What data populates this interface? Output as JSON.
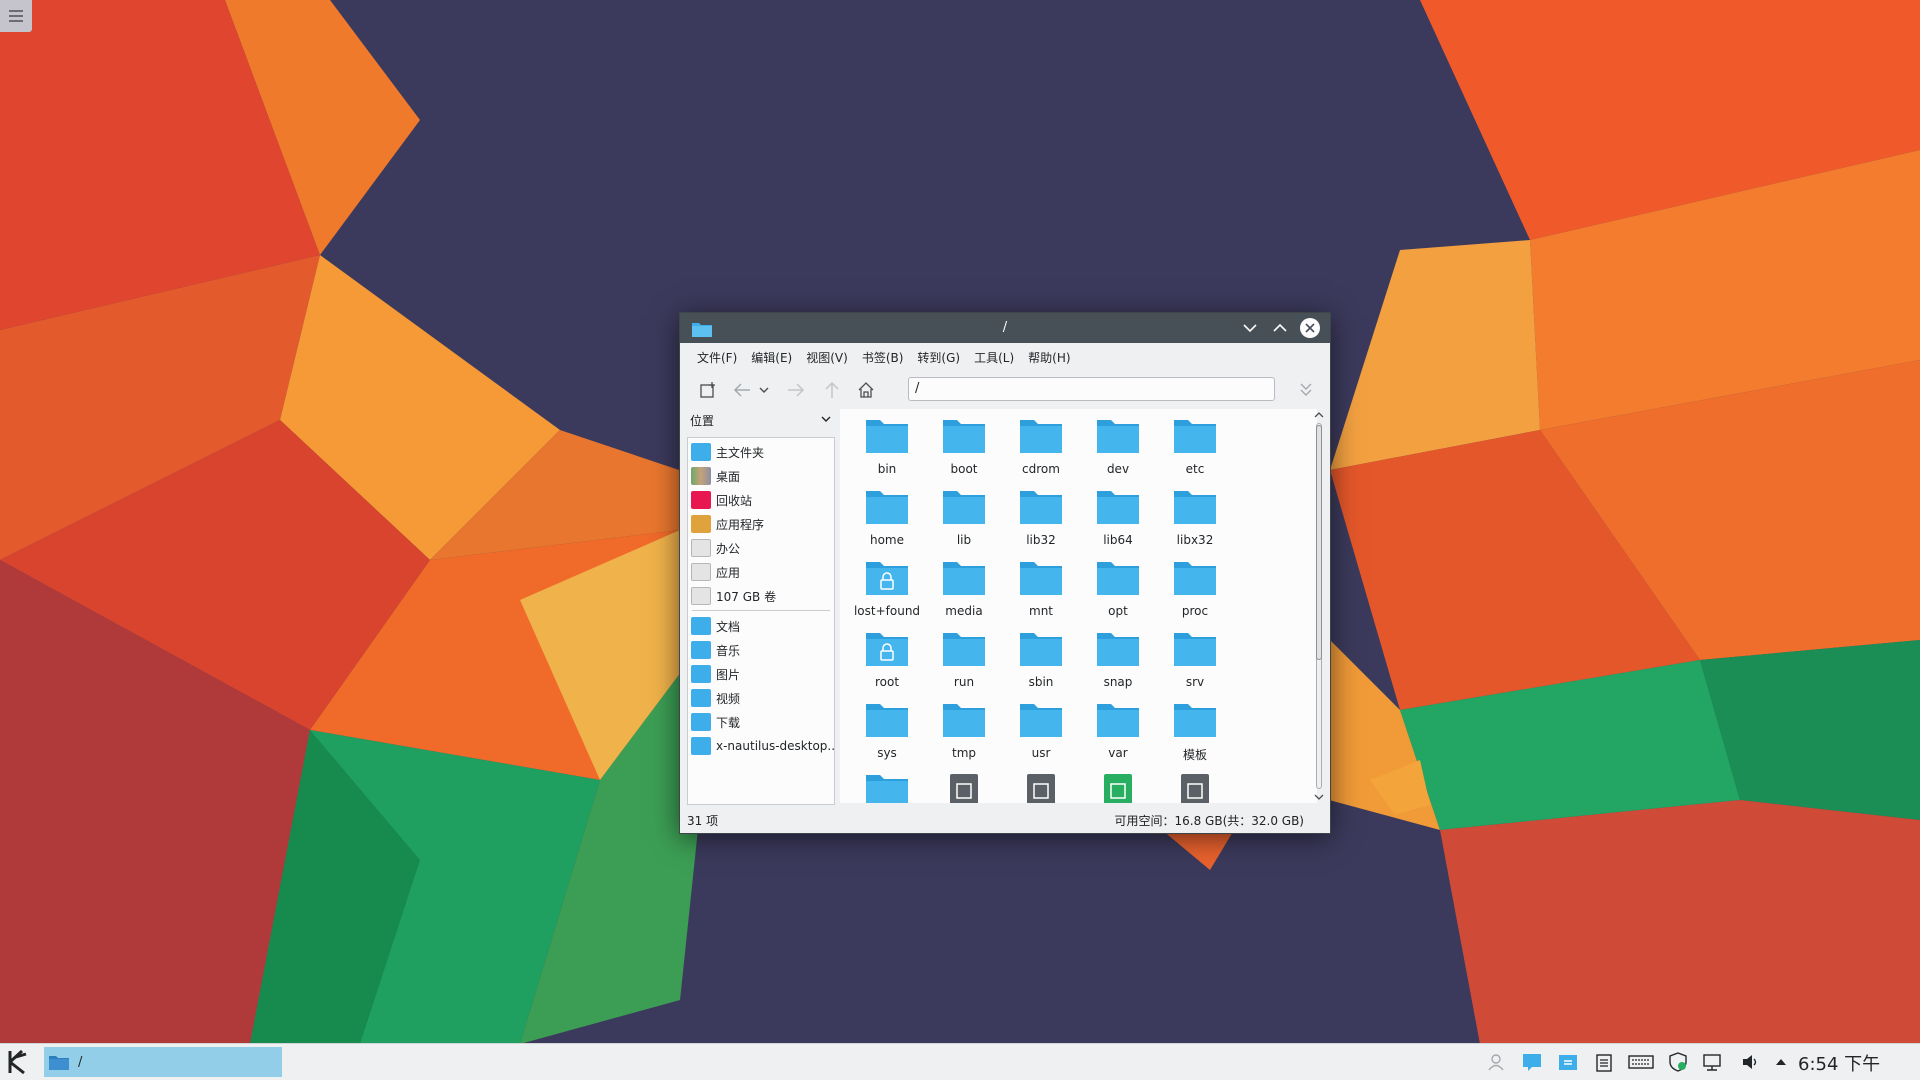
{
  "window": {
    "title": "/",
    "menu": [
      "文件(F)",
      "编辑(E)",
      "视图(V)",
      "书签(B)",
      "转到(G)",
      "工具(L)",
      "帮助(H)"
    ],
    "address": "/"
  },
  "places": {
    "header": "位置",
    "items": [
      "主文件夹",
      "桌面",
      "回收站",
      "应用程序",
      "办公",
      "应用",
      "107 GB 卷"
    ],
    "items2": [
      "文档",
      "音乐",
      "图片",
      "视频",
      "下载",
      "x-nautilus-desktop..."
    ]
  },
  "files": [
    "bin",
    "boot",
    "cdrom",
    "dev",
    "etc",
    "home",
    "lib",
    "lib32",
    "lib64",
    "libx32",
    "lost+found",
    "media",
    "mnt",
    "opt",
    "proc",
    "root",
    "run",
    "sbin",
    "snap",
    "srv",
    "sys",
    "tmp",
    "usr",
    "var",
    "模板"
  ],
  "status": {
    "count": "31 项",
    "free": "可用空间：16.8 GB(共：32.0 GB)"
  },
  "panel": {
    "task_label": "/",
    "clock": "6:54 下午"
  },
  "colors": {
    "folder": "#3daee9",
    "titlebar": "#475057",
    "selection": "#93cee9"
  }
}
